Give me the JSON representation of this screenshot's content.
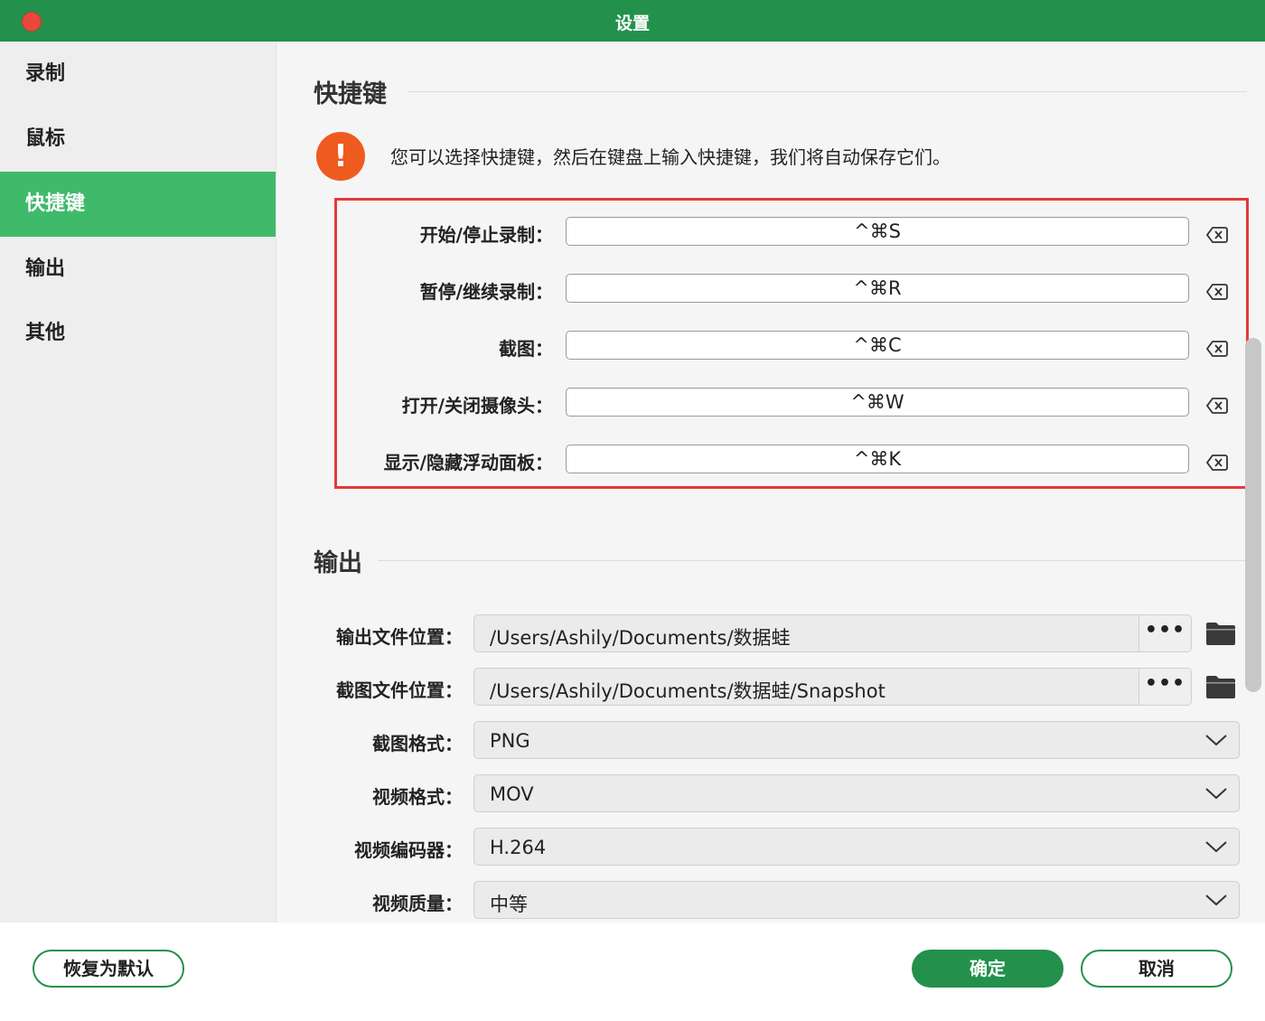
{
  "window": {
    "title": "设置"
  },
  "sidebar": {
    "items": [
      {
        "label": "录制",
        "active": false
      },
      {
        "label": "鼠标",
        "active": false
      },
      {
        "label": "快捷键",
        "active": true
      },
      {
        "label": "输出",
        "active": false
      },
      {
        "label": "其他",
        "active": false
      }
    ]
  },
  "hotkeys": {
    "heading": "快捷键",
    "notice": "您可以选择快捷键，然后在键盘上输入快捷键，我们将自动保存它们。",
    "rows": [
      {
        "label": "开始/停止录制：",
        "value": "^⌘S"
      },
      {
        "label": "暂停/继续录制：",
        "value": "^⌘R"
      },
      {
        "label": "截图：",
        "value": "^⌘C"
      },
      {
        "label": "打开/关闭摄像头：",
        "value": "^⌘W"
      },
      {
        "label": "显示/隐藏浮动面板：",
        "value": "^⌘K"
      }
    ]
  },
  "output": {
    "heading": "输出",
    "output_path": {
      "label": "输出文件位置：",
      "value": "/Users/Ashily/Documents/数据蛙",
      "button": "•••"
    },
    "snapshot_path": {
      "label": "截图文件位置：",
      "value": "/Users/Ashily/Documents/数据蛙/Snapshot",
      "button": "•••"
    },
    "snapshot_format": {
      "label": "截图格式：",
      "value": "PNG"
    },
    "video_format": {
      "label": "视频格式：",
      "value": "MOV"
    },
    "video_codec": {
      "label": "视频编码器：",
      "value": "H.264"
    },
    "video_quality": {
      "label": "视频质量：",
      "value": "中等"
    }
  },
  "footer": {
    "reset_label": "恢复为默认",
    "ok_label": "确定",
    "cancel_label": "取消"
  },
  "colors": {
    "titlebar": "#23904c",
    "sidebar_active": "#3fba6a",
    "highlight_border": "#e23a3a",
    "warning": "#ef5a1f"
  }
}
